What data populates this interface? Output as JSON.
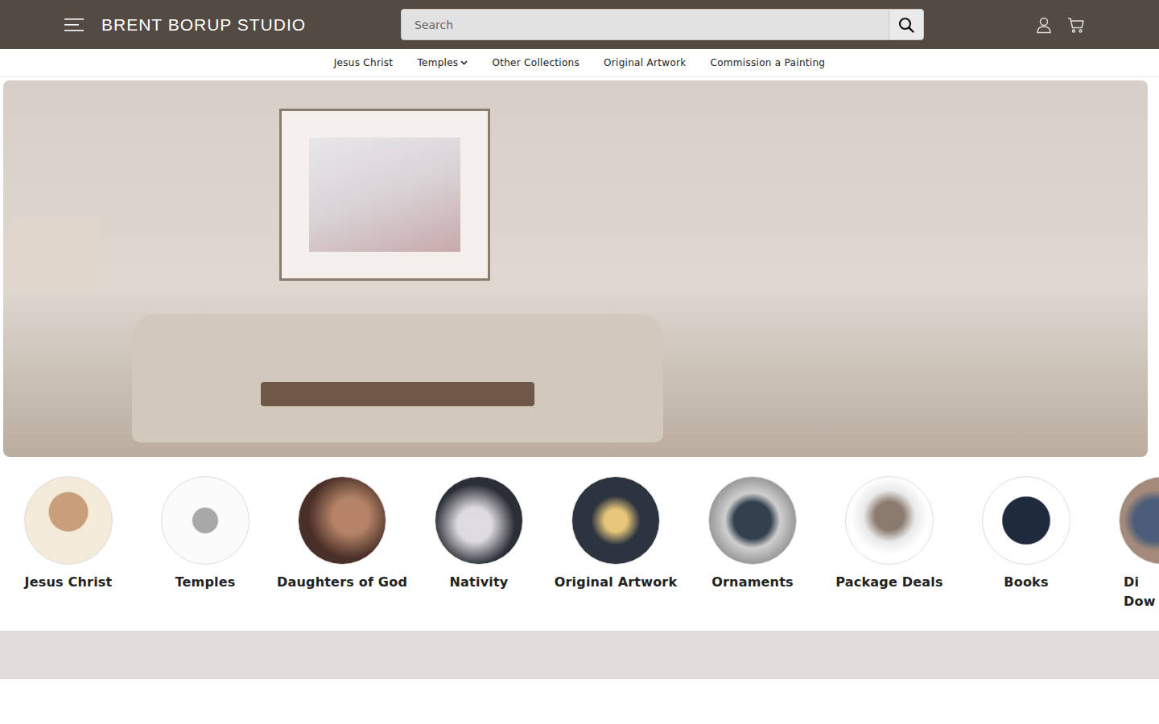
{
  "header": {
    "logo": "BRENT BORUP STUDIO",
    "search": {
      "placeholder": "Search"
    }
  },
  "nav": [
    {
      "label": "Jesus Christ",
      "has_dropdown": false
    },
    {
      "label": "Temples",
      "has_dropdown": true
    },
    {
      "label": "Other Collections",
      "has_dropdown": false
    },
    {
      "label": "Original Artwork",
      "has_dropdown": false
    },
    {
      "label": "Commission a Painting",
      "has_dropdown": false
    }
  ],
  "categories": [
    {
      "label": "Jesus Christ"
    },
    {
      "label": "Temples"
    },
    {
      "label": "Daughters of God"
    },
    {
      "label": "Nativity"
    },
    {
      "label": "Original Artwork"
    },
    {
      "label": "Ornaments"
    },
    {
      "label": "Package Deals"
    },
    {
      "label": "Books"
    },
    {
      "label": "Di Dow"
    }
  ]
}
